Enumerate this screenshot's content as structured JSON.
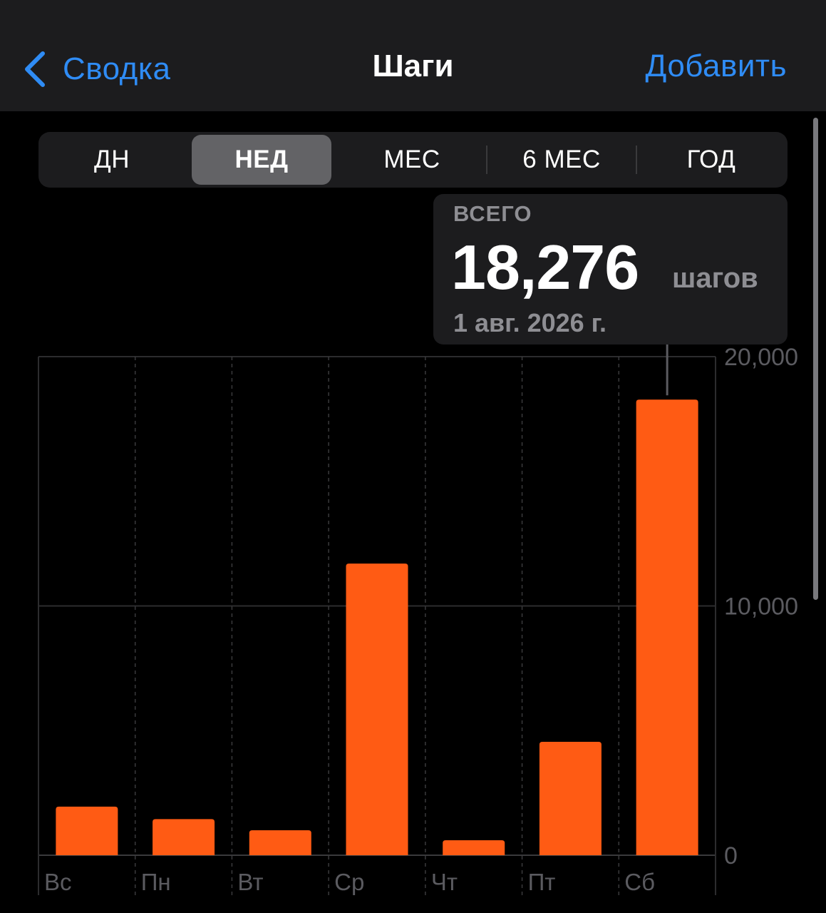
{
  "nav": {
    "back_label": "Сводка",
    "title": "Шаги",
    "add_label": "Добавить"
  },
  "segments": {
    "items": [
      "ДН",
      "НЕД",
      "МЕС",
      "6 МЕС",
      "ГОД"
    ],
    "selected": "НЕД"
  },
  "tooltip": {
    "label": "ВСЕГО",
    "value": "18,276",
    "unit": "шагов",
    "date": "1 авг. 2026 г."
  },
  "colors": {
    "accent_blue": "#2f8cf5",
    "bar": "#ff5b14",
    "background": "#000000",
    "panel": "#1c1c1e"
  },
  "chart_data": {
    "type": "bar",
    "categories": [
      "Вс",
      "Пн",
      "Вт",
      "Ср",
      "Чт",
      "Пт",
      "Сб"
    ],
    "values": [
      1950,
      1450,
      1000,
      11700,
      600,
      4550,
      18276
    ],
    "y_ticks": [
      "20,000",
      "10,000",
      "0"
    ],
    "y_tick_values": [
      20000,
      10000,
      0
    ],
    "ylim": [
      0,
      20000
    ],
    "highlighted": "Сб",
    "grid": true
  }
}
